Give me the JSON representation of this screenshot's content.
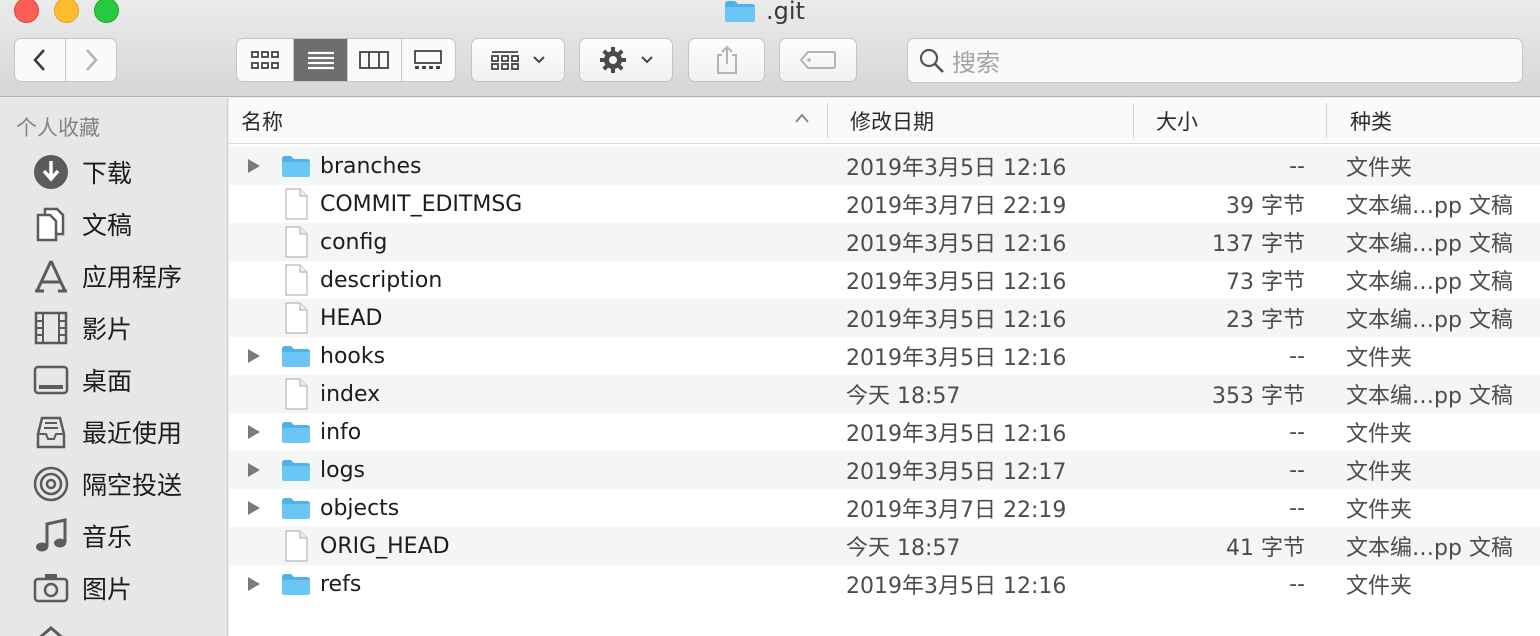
{
  "window": {
    "title": ".git"
  },
  "toolbar": {
    "back_label": "‹",
    "forward_label": "›",
    "search_placeholder": "搜索"
  },
  "sidebar": {
    "heading": "个人收藏",
    "items": [
      {
        "label": "下载",
        "icon": "download-icon"
      },
      {
        "label": "文稿",
        "icon": "documents-icon"
      },
      {
        "label": "应用程序",
        "icon": "applications-icon"
      },
      {
        "label": "影片",
        "icon": "movies-icon"
      },
      {
        "label": "桌面",
        "icon": "desktop-icon"
      },
      {
        "label": "最近使用",
        "icon": "recents-icon"
      },
      {
        "label": "隔空投送",
        "icon": "airdrop-icon"
      },
      {
        "label": "音乐",
        "icon": "music-icon"
      },
      {
        "label": "图片",
        "icon": "pictures-icon"
      }
    ]
  },
  "columns": {
    "name": "名称",
    "date": "修改日期",
    "size": "大小",
    "kind": "种类"
  },
  "files": [
    {
      "name": "branches",
      "date": "2019年3月5日 12:16",
      "size": "--",
      "kind": "文件夹",
      "folder": true
    },
    {
      "name": "COMMIT_EDITMSG",
      "date": "2019年3月7日 22:19",
      "size": "39 字节",
      "kind": "文本编…pp 文稿",
      "folder": false
    },
    {
      "name": "config",
      "date": "2019年3月5日 12:16",
      "size": "137 字节",
      "kind": "文本编…pp 文稿",
      "folder": false
    },
    {
      "name": "description",
      "date": "2019年3月5日 12:16",
      "size": "73 字节",
      "kind": "文本编…pp 文稿",
      "folder": false
    },
    {
      "name": "HEAD",
      "date": "2019年3月5日 12:16",
      "size": "23 字节",
      "kind": "文本编…pp 文稿",
      "folder": false
    },
    {
      "name": "hooks",
      "date": "2019年3月5日 12:16",
      "size": "--",
      "kind": "文件夹",
      "folder": true
    },
    {
      "name": "index",
      "date": "今天 18:57",
      "size": "353 字节",
      "kind": "文本编…pp 文稿",
      "folder": false
    },
    {
      "name": "info",
      "date": "2019年3月5日 12:16",
      "size": "--",
      "kind": "文件夹",
      "folder": true
    },
    {
      "name": "logs",
      "date": "2019年3月5日 12:17",
      "size": "--",
      "kind": "文件夹",
      "folder": true
    },
    {
      "name": "objects",
      "date": "2019年3月7日 22:19",
      "size": "--",
      "kind": "文件夹",
      "folder": true
    },
    {
      "name": "ORIG_HEAD",
      "date": "今天 18:57",
      "size": "41 字节",
      "kind": "文本编…pp 文稿",
      "folder": false
    },
    {
      "name": "refs",
      "date": "2019年3月5日 12:16",
      "size": "--",
      "kind": "文件夹",
      "folder": true
    }
  ],
  "colors": {
    "folder": "#6cc6f5",
    "folder_tab": "#4fb2ea",
    "selected_segment": "#6e6e6e"
  }
}
